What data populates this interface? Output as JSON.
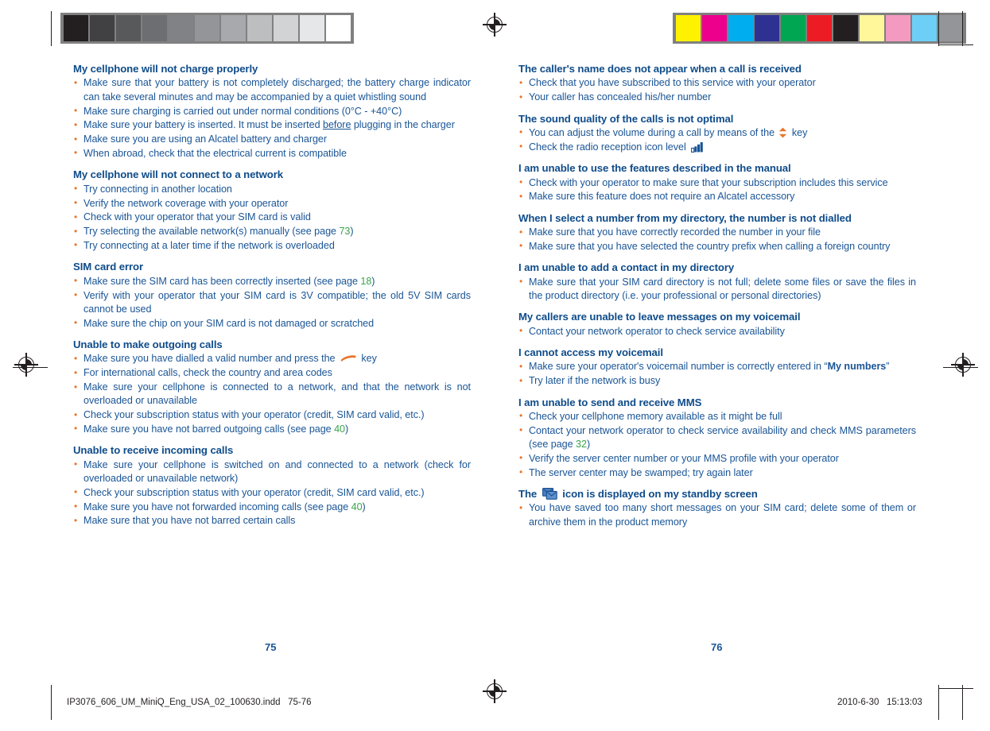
{
  "print_marks": {
    "gray_strip": {
      "name": "grayscale-calibration-strip",
      "swatches": [
        "#231f20",
        "#414042",
        "#58595b",
        "#6d6e71",
        "#808285",
        "#939598",
        "#a7a9ac",
        "#bcbec0",
        "#d1d3d4",
        "#e6e7e8",
        "#ffffff"
      ]
    },
    "color_strip": {
      "name": "color-calibration-strip",
      "swatches": [
        "#fff200",
        "#ec008c",
        "#00aeef",
        "#2e3192",
        "#00a651",
        "#ed1c24",
        "#231f20",
        "#fff79a",
        "#f49ac1",
        "#6dcff6",
        "#939598"
      ]
    }
  },
  "left_page": {
    "page_number": "75",
    "sections": [
      {
        "title": "My cellphone will not charge properly",
        "items": [
          {
            "text": "Make sure that your battery is not completely discharged; the battery charge indicator can take several minutes and may be accompanied by a quiet whistling sound"
          },
          {
            "text": "Make sure charging is carried out under normal conditions (0°C - +40°C)",
            "justify": false
          },
          {
            "pre": "Make sure your battery is inserted. It must be inserted ",
            "underline": "before",
            "post": " plugging in the charger"
          },
          {
            "text": "Make sure you are using an Alcatel battery and charger",
            "justify": false
          },
          {
            "text": "When abroad, check that the electrical current is compatible",
            "justify": false
          }
        ]
      },
      {
        "title": "My cellphone will not connect to a network",
        "items": [
          {
            "text": "Try connecting in another location",
            "justify": false
          },
          {
            "text": "Verify the network coverage with your operator",
            "justify": false
          },
          {
            "text": "Check with your operator that your SIM card is valid",
            "justify": false
          },
          {
            "pre": "Try selecting the available network(s) manually (see page ",
            "pageref": "73",
            "post": ")",
            "justify": false
          },
          {
            "text": "Try connecting at a later time if the network is overloaded",
            "justify": false
          }
        ]
      },
      {
        "title": "SIM card error",
        "items": [
          {
            "pre": "Make sure the SIM card has been correctly inserted (see page ",
            "pageref": "18",
            "post": ")",
            "justify": false
          },
          {
            "text": "Verify with your operator that your SIM card is 3V compatible; the old 5V SIM cards cannot be used"
          },
          {
            "text": "Make sure the chip on your SIM card is not damaged or scratched",
            "justify": false
          }
        ]
      },
      {
        "title": "Unable to make outgoing calls",
        "items": [
          {
            "pre": "Make sure you have dialled a valid number and press the ",
            "icon": "call-key-icon",
            "post": " key",
            "justify": false
          },
          {
            "text": "For international calls, check the country and area codes",
            "justify": false
          },
          {
            "text": "Make sure your cellphone is connected to a network, and that the network is not overloaded or unavailable"
          },
          {
            "text": "Check your subscription status with your operator (credit, SIM card valid, etc.)",
            "justify": false
          },
          {
            "pre": "Make sure you have not barred outgoing calls (see page ",
            "pageref": "40",
            "post": ")",
            "justify": false
          }
        ]
      },
      {
        "title": "Unable to receive incoming calls",
        "items": [
          {
            "text": "Make sure your cellphone is switched on and connected to a network (check for overloaded or unavailable network)"
          },
          {
            "text": "Check your subscription status with your operator (credit, SIM card valid, etc.)",
            "justify": false
          },
          {
            "pre": "Make sure you have not forwarded incoming calls (see page ",
            "pageref": "40",
            "post": ")",
            "justify": false
          },
          {
            "text": "Make sure that you have not barred certain calls",
            "justify": false
          }
        ]
      }
    ]
  },
  "right_page": {
    "page_number": "76",
    "sections": [
      {
        "title": "The caller's name does not appear when a call is received",
        "items": [
          {
            "text": "Check that you have subscribed to this service with your operator",
            "justify": false
          },
          {
            "text": "Your caller has concealed his/her number",
            "justify": false
          }
        ]
      },
      {
        "title": "The sound quality of the calls is not optimal",
        "items": [
          {
            "pre": "You can adjust the volume during a call by means of the ",
            "icon": "volume-key-icon",
            "post": " key",
            "justify": false
          },
          {
            "pre": "Check the radio reception icon level ",
            "icon": "signal-bars-icon",
            "post": "",
            "justify": false
          }
        ]
      },
      {
        "title": "I am unable to use the features described in the manual",
        "items": [
          {
            "text": "Check with your operator to make sure that your subscription includes this service"
          },
          {
            "text": "Make sure this feature does not require an Alcatel accessory",
            "justify": false
          }
        ]
      },
      {
        "title": "When I select a number from my directory, the number is not dialled",
        "items": [
          {
            "text": "Make sure that you have correctly recorded the number in your file",
            "justify": false
          },
          {
            "text": "Make sure that you have selected the country prefix when calling a foreign country"
          }
        ]
      },
      {
        "title": "I am unable to add a contact in my directory",
        "items": [
          {
            "text": "Make sure that your SIM card directory is not full; delete some files or save the files in the product directory (i.e. your professional or personal directories)"
          }
        ]
      },
      {
        "title": "My callers are unable to leave messages on my voicemail",
        "items": [
          {
            "text": "Contact your network operator to check service availability",
            "justify": false
          }
        ]
      },
      {
        "title": "I cannot access my voicemail",
        "items": [
          {
            "pre": "Make sure your operator's voicemail number is correctly entered in “",
            "bold": "My numbers",
            "post": "”"
          },
          {
            "text": "Try later if the network is busy",
            "justify": false
          }
        ]
      },
      {
        "title": "I am unable to send and receive MMS",
        "items": [
          {
            "text": "Check your cellphone memory available as it might be full",
            "justify": false
          },
          {
            "pre": "Contact your network operator to check service availability and check MMS parameters (see page ",
            "pageref": "32",
            "post": ")"
          },
          {
            "text": "Verify the server center number or your MMS profile with your operator",
            "justify": false
          },
          {
            "text": "The server center may be swamped; try again later",
            "justify": false
          }
        ]
      },
      {
        "title_parts": {
          "pre": "The ",
          "icon": "messages-full-icon",
          "post": " icon is displayed on my standby screen"
        },
        "items": [
          {
            "text": "You have saved too many short messages on your SIM card; delete some of them or archive them in the product memory"
          }
        ]
      }
    ]
  },
  "footer": {
    "file_slug": "IP3076_606_UM_MiniQ_Eng_USA_02_100630.indd   75-76",
    "timestamp": "2010-6-30   15:13:03"
  },
  "colors": {
    "heading_blue": "#0f4c8a",
    "body_blue": "#1a5596",
    "bullet_orange": "#e8762c",
    "pageref_green": "#3aa34a",
    "mark_black": "#231f20"
  }
}
